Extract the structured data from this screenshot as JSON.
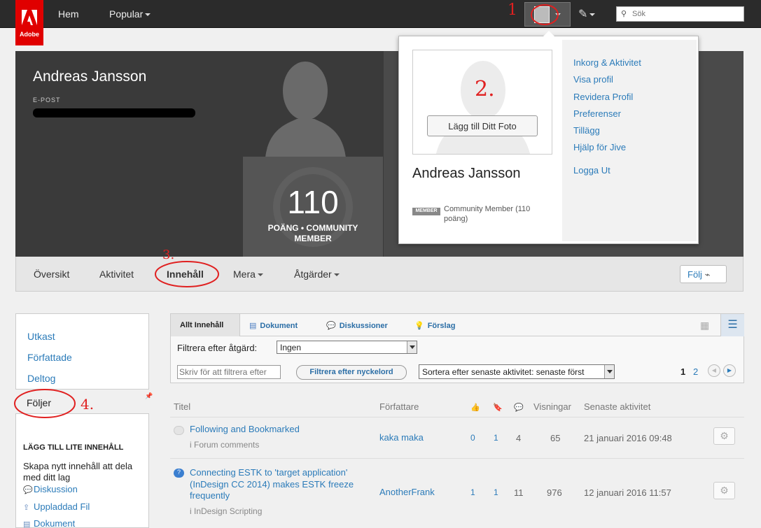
{
  "topbar": {
    "logo_text": "Adobe",
    "nav_home": "Hem",
    "nav_popular": "Popular",
    "search_placeholder": "Sök"
  },
  "annotations": {
    "a1": "1",
    "a2": "2.",
    "a3": "3.",
    "a4": "4."
  },
  "profile": {
    "name": "Andreas Jansson",
    "email_label": "E-POST",
    "points": "110",
    "points_label_1": "POÄNG • COMMUNITY",
    "points_label_2": "MEMBER"
  },
  "profile_tabs": {
    "overview": "Översikt",
    "activity": "Aktivitet",
    "content": "Innehåll",
    "more": "Mera",
    "actions": "Åtgärder",
    "follow": "Följ"
  },
  "popup": {
    "add_photo": "Lägg till Ditt Foto",
    "name": "Andreas Jansson",
    "badge": "MEMBER",
    "member_text": "Community Member (110 poäng)",
    "menu": [
      "Inkorg & Aktivitet",
      "Visa profil",
      "Revidera Profil",
      "Preferenser",
      "Tillägg",
      "Hjälp för Jive",
      "Logga Ut"
    ]
  },
  "sidebar": {
    "items": [
      "Utkast",
      "Författade",
      "Deltog"
    ],
    "active": "Följer",
    "add_heading": "LÄGG TILL LITE INNEHÅLL",
    "add_text": "Skapa nytt innehåll att dela med ditt lag",
    "links": [
      "Diskussion",
      "Uppladdad Fil",
      "Dokument"
    ]
  },
  "content_tabs": {
    "all": "Allt Innehåll",
    "documents": "Dokument",
    "discussions": "Diskussioner",
    "suggestions": "Förslag"
  },
  "filters": {
    "action_label": "Filtrera efter åtgärd:",
    "action_value": "Ingen",
    "keyword_placeholder": "Skriv för att filtrera efter",
    "keyword_button": "Filtrera efter nyckelord",
    "sort_value": "Sortera efter senaste aktivitet: senaste först",
    "pages": [
      "1",
      "2"
    ]
  },
  "table": {
    "headers": {
      "title": "Titel",
      "author": "Författare",
      "views": "Visningar",
      "latest": "Senaste aktivitet"
    },
    "rows": [
      {
        "title": "Following and Bookmarked",
        "place": "i Forum comments",
        "author": "kaka maka",
        "likes": "0",
        "bookmarks": "1",
        "replies": "4",
        "views": "65",
        "latest": "21 januari 2016 09:48"
      },
      {
        "title": "Connecting ESTK to 'target application' (InDesign CC 2014) makes ESTK freeze frequently",
        "place": "i InDesign Scripting",
        "author": "AnotherFrank",
        "likes": "1",
        "bookmarks": "1",
        "replies": "11",
        "views": "976",
        "latest": "12 januari 2016 11:57"
      }
    ]
  },
  "colors": {
    "accent": "#2b7bb9",
    "brand_red": "#e00000",
    "annotation_red": "#e02020"
  }
}
